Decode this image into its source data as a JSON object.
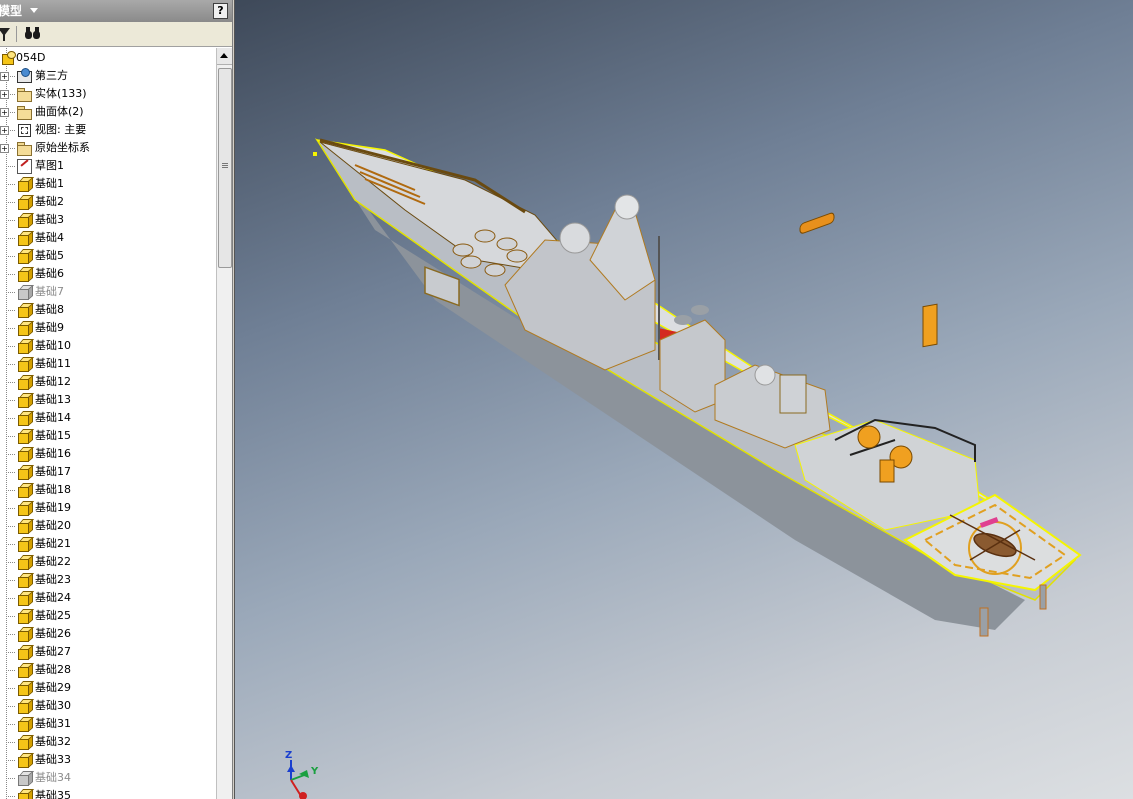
{
  "browser": {
    "title": "模型",
    "help_label": "?",
    "icons": {
      "filter": "filter-icon",
      "find": "binoculars-icon"
    },
    "tree": [
      {
        "label": "054D",
        "icon": "part-icon",
        "level": 0
      },
      {
        "label": "第三方",
        "icon": "third-party-icon",
        "level": 1,
        "expander": "+"
      },
      {
        "label": "实体(133)",
        "icon": "folder-icon",
        "level": 1,
        "expander": "+"
      },
      {
        "label": "曲面体(2)",
        "icon": "folder-icon",
        "level": 1,
        "expander": "+"
      },
      {
        "label": "视图: 主要",
        "icon": "view-icon",
        "level": 1,
        "expander": "+"
      },
      {
        "label": "原始坐标系",
        "icon": "folder-icon",
        "level": 1,
        "expander": "+"
      },
      {
        "label": "草图1",
        "icon": "sketch-icon",
        "level": 1
      },
      {
        "label": "基础1",
        "icon": "feature-icon",
        "level": 1
      },
      {
        "label": "基础2",
        "icon": "feature-icon",
        "level": 1
      },
      {
        "label": "基础3",
        "icon": "feature-icon",
        "level": 1
      },
      {
        "label": "基础4",
        "icon": "feature-icon",
        "level": 1
      },
      {
        "label": "基础5",
        "icon": "feature-icon",
        "level": 1
      },
      {
        "label": "基础6",
        "icon": "feature-icon",
        "level": 1
      },
      {
        "label": "基础7",
        "icon": "feature-icon",
        "level": 1,
        "disabled": true
      },
      {
        "label": "基础8",
        "icon": "feature-icon",
        "level": 1
      },
      {
        "label": "基础9",
        "icon": "feature-icon",
        "level": 1
      },
      {
        "label": "基础10",
        "icon": "feature-icon",
        "level": 1
      },
      {
        "label": "基础11",
        "icon": "feature-icon",
        "level": 1
      },
      {
        "label": "基础12",
        "icon": "feature-icon",
        "level": 1
      },
      {
        "label": "基础13",
        "icon": "feature-icon",
        "level": 1
      },
      {
        "label": "基础14",
        "icon": "feature-icon",
        "level": 1
      },
      {
        "label": "基础15",
        "icon": "feature-icon",
        "level": 1
      },
      {
        "label": "基础16",
        "icon": "feature-icon",
        "level": 1
      },
      {
        "label": "基础17",
        "icon": "feature-icon",
        "level": 1
      },
      {
        "label": "基础18",
        "icon": "feature-icon",
        "level": 1
      },
      {
        "label": "基础19",
        "icon": "feature-icon",
        "level": 1
      },
      {
        "label": "基础20",
        "icon": "feature-icon",
        "level": 1
      },
      {
        "label": "基础21",
        "icon": "feature-icon",
        "level": 1
      },
      {
        "label": "基础22",
        "icon": "feature-icon",
        "level": 1
      },
      {
        "label": "基础23",
        "icon": "feature-icon",
        "level": 1
      },
      {
        "label": "基础24",
        "icon": "feature-icon",
        "level": 1
      },
      {
        "label": "基础25",
        "icon": "feature-icon",
        "level": 1
      },
      {
        "label": "基础26",
        "icon": "feature-icon",
        "level": 1
      },
      {
        "label": "基础27",
        "icon": "feature-icon",
        "level": 1
      },
      {
        "label": "基础28",
        "icon": "feature-icon",
        "level": 1
      },
      {
        "label": "基础29",
        "icon": "feature-icon",
        "level": 1
      },
      {
        "label": "基础30",
        "icon": "feature-icon",
        "level": 1
      },
      {
        "label": "基础31",
        "icon": "feature-icon",
        "level": 1
      },
      {
        "label": "基础32",
        "icon": "feature-icon",
        "level": 1
      },
      {
        "label": "基础33",
        "icon": "feature-icon",
        "level": 1
      },
      {
        "label": "基础34",
        "icon": "feature-icon",
        "level": 1,
        "disabled": true
      },
      {
        "label": "基础35",
        "icon": "feature-icon",
        "level": 1
      }
    ]
  },
  "viewport": {
    "model": "ship-model",
    "triad": {
      "z_label": "Z",
      "y_label": "Y"
    }
  },
  "colors": {
    "selection": "#f5f500",
    "accent": "#f0a020",
    "hull": "#c9ccd1",
    "flag": "#d42a1e"
  }
}
